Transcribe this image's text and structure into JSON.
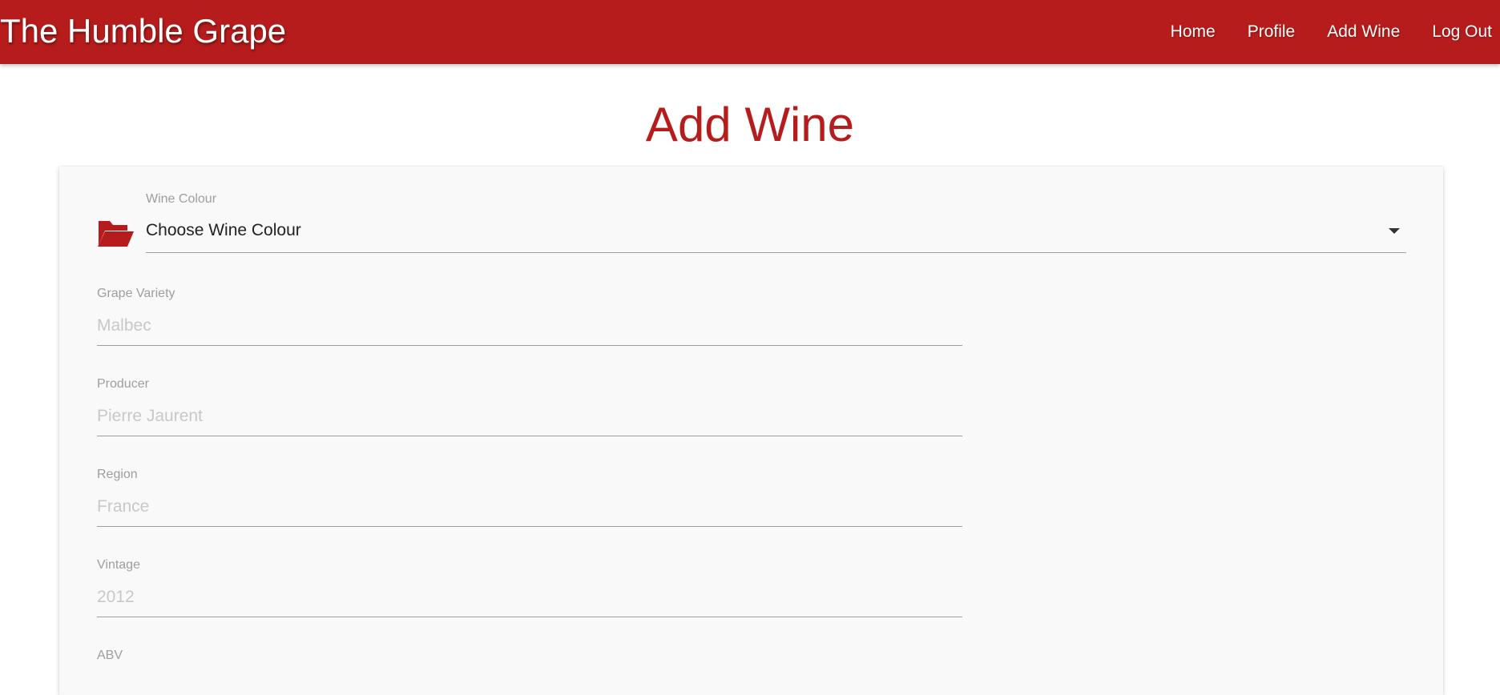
{
  "brand": {
    "title": "The Humble Grape"
  },
  "nav": {
    "items": [
      {
        "label": "Home"
      },
      {
        "label": "Profile"
      },
      {
        "label": "Add Wine"
      },
      {
        "label": "Log Out"
      }
    ]
  },
  "page": {
    "title": "Add Wine"
  },
  "form": {
    "wine_colour": {
      "label": "Wine Colour",
      "selected": "Choose Wine Colour"
    },
    "grape_variety": {
      "label": "Grape Variety",
      "placeholder": "Malbec",
      "value": ""
    },
    "producer": {
      "label": "Producer",
      "placeholder": "Pierre Jaurent",
      "value": ""
    },
    "region": {
      "label": "Region",
      "placeholder": "France",
      "value": ""
    },
    "vintage": {
      "label": "Vintage",
      "placeholder": "2012",
      "value": ""
    },
    "abv": {
      "label": "ABV"
    }
  },
  "colors": {
    "brand": "#b71c1c",
    "card_bg": "#f9f9f9",
    "label": "#9e9e9e"
  },
  "icons": {
    "wine_colour": "folder-open-icon",
    "dropdown": "caret-down-icon"
  }
}
